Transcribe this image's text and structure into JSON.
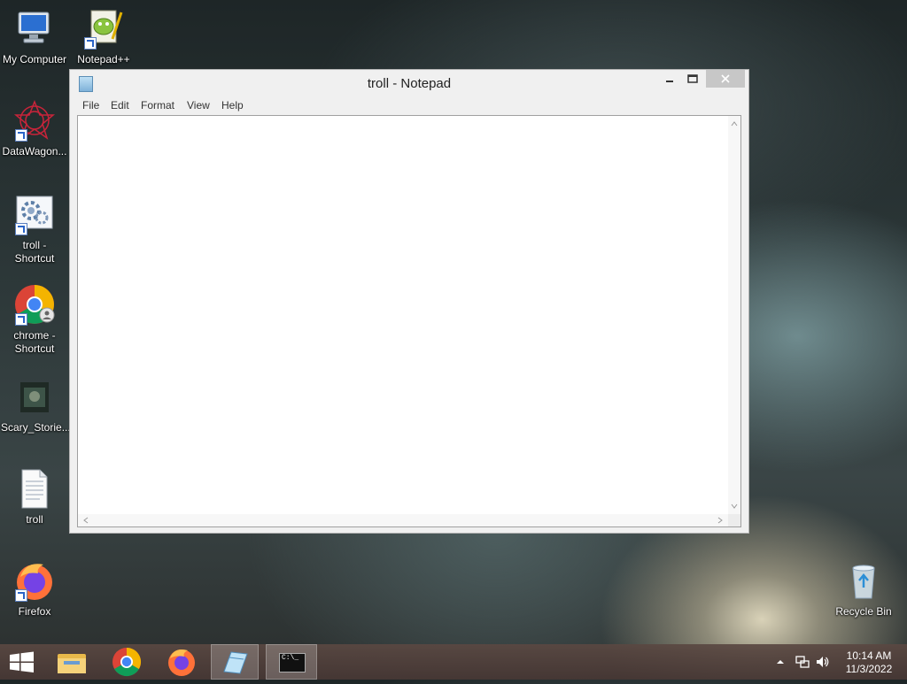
{
  "desktop": {
    "icons": [
      {
        "label": "My Computer"
      },
      {
        "label": "Notepad++"
      },
      {
        "label": "DataWagon..."
      },
      {
        "label": "troll -\nShortcut"
      },
      {
        "label": "chrome -\nShortcut"
      },
      {
        "label": "Scary_Storie..."
      },
      {
        "label": "troll"
      },
      {
        "label": "Firefox"
      },
      {
        "label": "Recycle Bin"
      }
    ]
  },
  "notepad": {
    "title": "troll - Notepad",
    "menu": [
      "File",
      "Edit",
      "Format",
      "View",
      "Help"
    ],
    "content": ""
  },
  "taskbar": {
    "time": "10:14 AM",
    "date": "11/3/2022",
    "cmd_text": "C:\\_"
  },
  "colors": {
    "chrome_red": "#db4437",
    "chrome_green": "#0f9d58",
    "chrome_yellow": "#f4b400",
    "chrome_blue": "#4285f4",
    "firefox_orange": "#ff7139",
    "firefox_purple": "#7542e5"
  }
}
